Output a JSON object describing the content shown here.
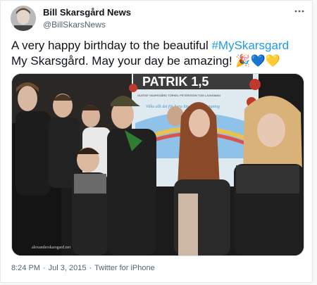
{
  "tweet": {
    "display_name": "Bill Skarsgård News",
    "handle": "@BillSkarsNews",
    "text_before": "A very happy birthday to the beautiful ",
    "hashtag": "#MySkarsgard",
    "text_after": " My Skarsgård. May your day be amazing! ",
    "emojis": "🎉💙💛",
    "time": "8:24 PM",
    "separator1": "·",
    "date": "Jul 3, 2015",
    "separator2": "·",
    "source": "Twitter for iPhone"
  },
  "photo": {
    "poster_title": "PATRIK 1,5",
    "poster_names": "GUSTAF SKARSGÅRD   TORKEL PETERSSON   TOM LJUNGMAN",
    "poster_tagline": "Vilka allt det för bara lön är en förlängning",
    "watermark": "alexanderskarsgard.net"
  },
  "icons": {
    "more": "more-dots-icon",
    "avatar": "profile-avatar"
  },
  "colors": {
    "hashtag": "#1d9bf0",
    "text": "#0f1419",
    "secondary": "#536471",
    "poster_blue": "#4a8fc7"
  }
}
